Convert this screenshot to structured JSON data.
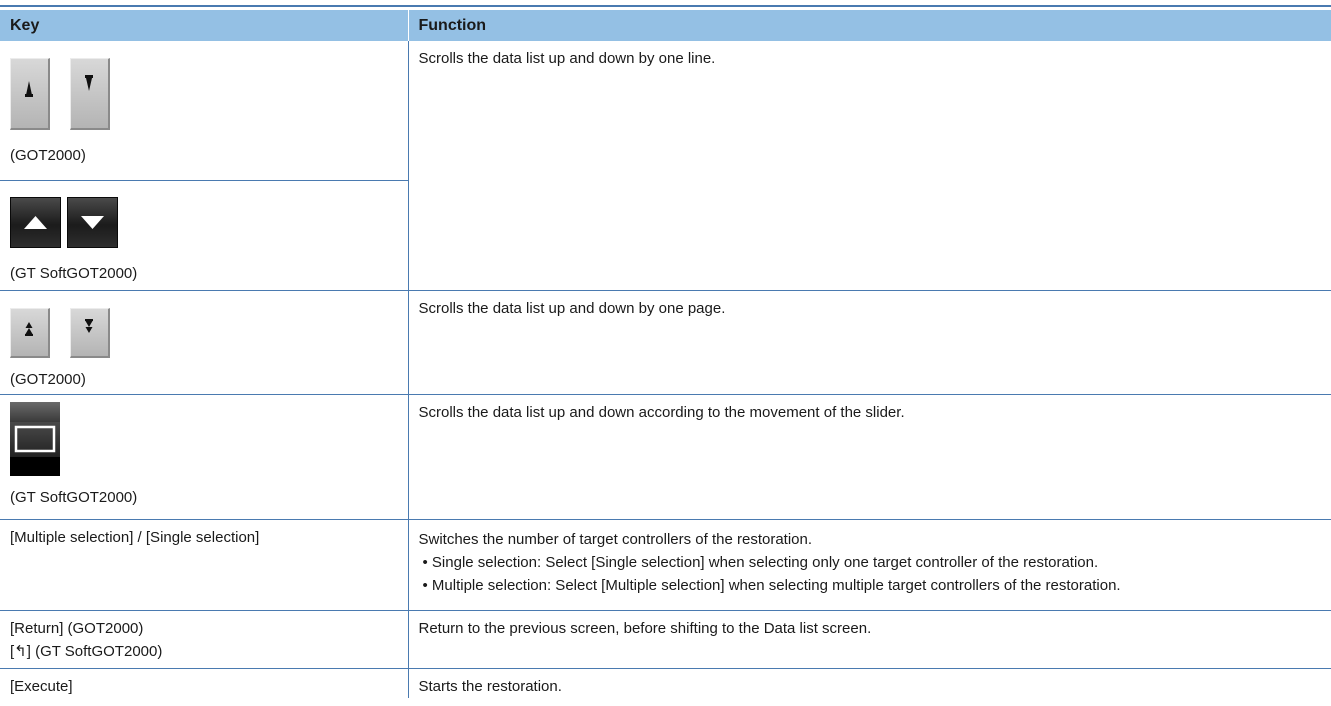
{
  "table": {
    "headers": {
      "key": "Key",
      "function": "Function"
    },
    "rows": [
      {
        "key_caption_got": "(GOT2000)",
        "key_caption_soft": "(GT SoftGOT2000)",
        "function": "Scrolls the data list up and down by one line."
      },
      {
        "key_caption": "(GOT2000)",
        "function": "Scrolls the data list up and down by one page."
      },
      {
        "key_caption": "(GT SoftGOT2000)",
        "function": "Scrolls the data list up and down according to the movement of the slider."
      },
      {
        "key": "[Multiple selection] / [Single selection]",
        "function": "Switches the number of target controllers of the restoration.",
        "bullets": [
          "• Single selection: Select [Single selection] when selecting only one target controller of the restoration.",
          "• Multiple selection: Select [Multiple selection] when selecting multiple target controllers of the restoration."
        ]
      },
      {
        "key_line1": "[Return] (GOT2000)",
        "key_line2": "[↰] (GT SoftGOT2000)",
        "function": "Return to the previous screen, before shifting to the Data list screen."
      },
      {
        "key": "[Execute]",
        "function": "Starts the restoration."
      }
    ]
  },
  "icons": {
    "got_line_up": "scroll-line-up-icon",
    "got_line_down": "scroll-line-down-icon",
    "soft_line_up": "triangle-up-icon",
    "soft_line_down": "triangle-down-icon",
    "got_page_up": "scroll-page-up-icon",
    "got_page_down": "scroll-page-down-icon",
    "soft_slider": "slider-icon"
  },
  "colors": {
    "header_bg": "#94c0e4",
    "rule": "#4a7ab0"
  }
}
